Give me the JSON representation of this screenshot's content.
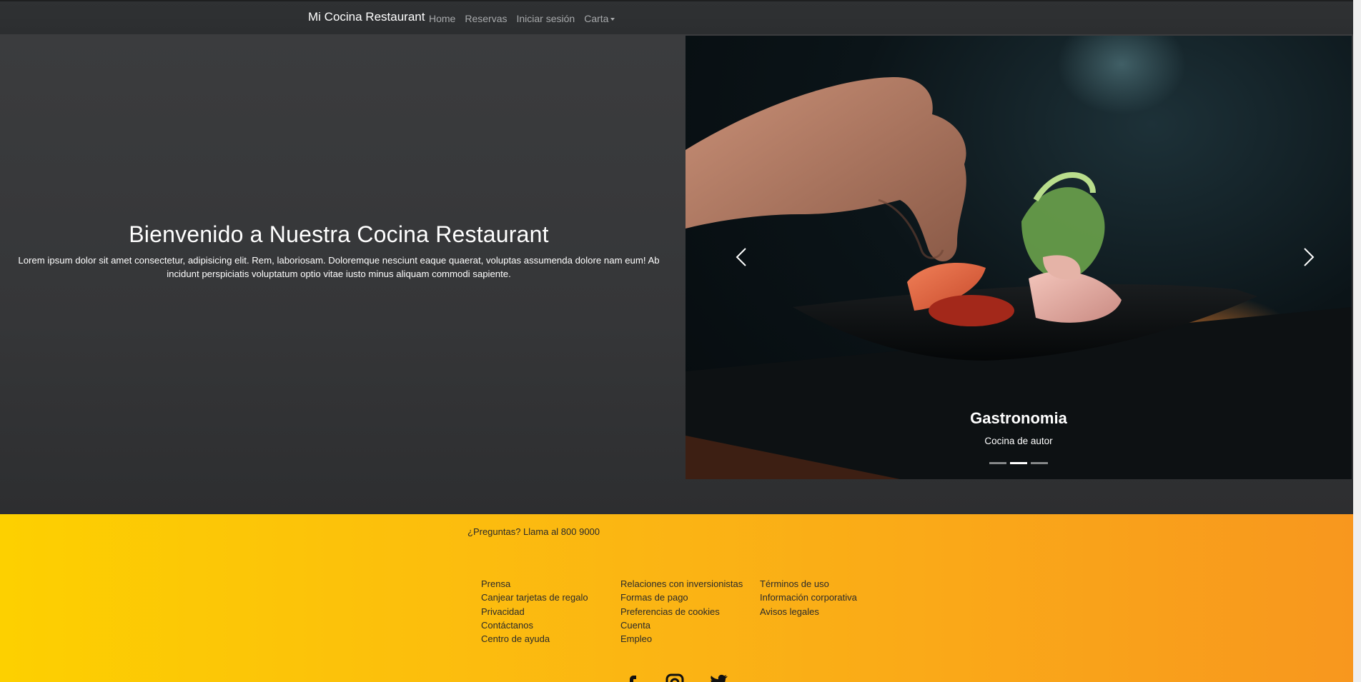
{
  "navbar": {
    "brand": "Mi Cocina Restaurant",
    "links": [
      "Home",
      "Reservas",
      "Iniciar sesión",
      "Carta"
    ]
  },
  "hero": {
    "title": "Bienvenido a Nuestra Cocina Restaurant",
    "description": "Lorem ipsum dolor sit amet consectetur, adipisicing elit. Rem, laboriosam. Doloremque nesciunt eaque quaerat, voluptas assumenda dolore nam eum! Ab incidunt perspiciatis voluptatum optio vitae iusto minus aliquam commodi sapiente."
  },
  "carousel": {
    "caption_title": "Gastronomia",
    "caption_text": "Cocina de autor",
    "indicator_count": 3,
    "active_indicator": 2
  },
  "footer": {
    "call": "¿Preguntas? Llama al 800 9000",
    "col1": [
      "Prensa",
      "Canjear tarjetas de regalo",
      "Privacidad",
      "Contáctanos",
      "Centro de ayuda"
    ],
    "col2": [
      "Relaciones con inversionistas",
      "Formas de pago",
      "Preferencias de cookies",
      "Cuenta",
      "Empleo"
    ],
    "col3": [
      "Términos de uso",
      "Información corporativa",
      "Avisos legales"
    ],
    "social": [
      "facebook-icon",
      "instagram-icon",
      "twitter-icon"
    ]
  },
  "colors": {
    "footer_start": "#fdd000",
    "footer_end": "#f8971e",
    "navbar": "#2e3032"
  }
}
